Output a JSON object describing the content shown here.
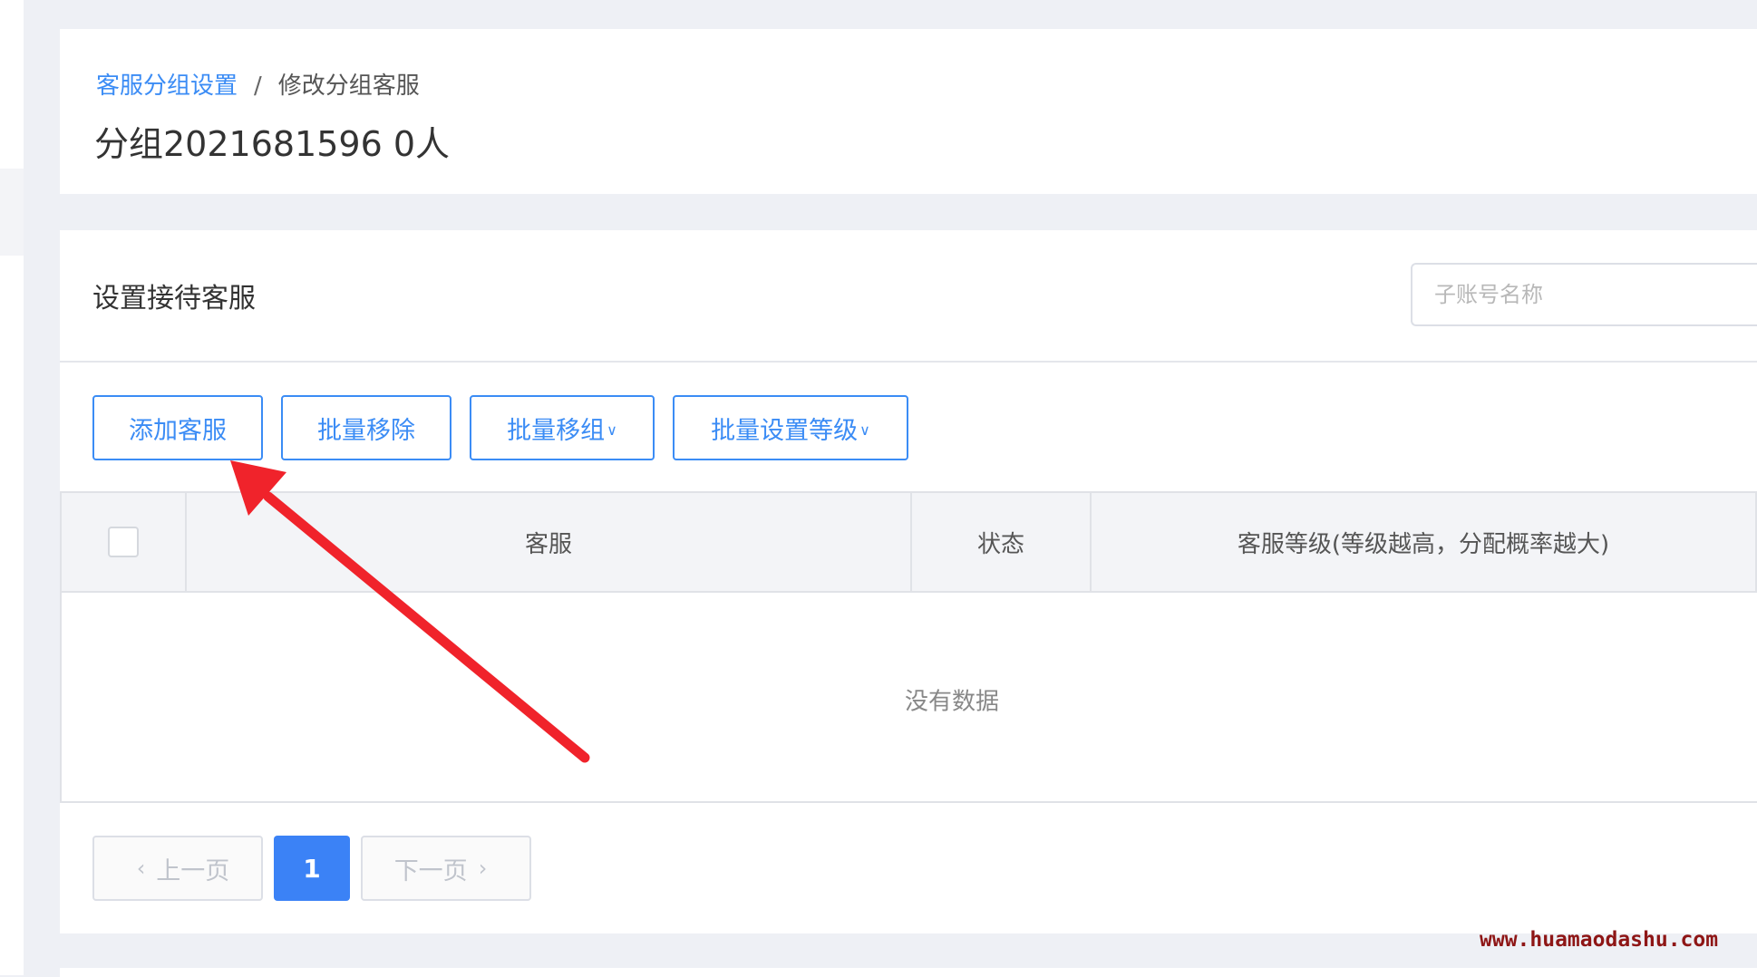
{
  "breadcrumb": {
    "parent": "客服分组设置",
    "separator": "/",
    "current": "修改分组客服"
  },
  "page_title": "分组2021681596 0人",
  "section": {
    "title": "设置接待客服",
    "search_placeholder": "子账号名称"
  },
  "toolbar": {
    "add_label": "添加客服",
    "batch_remove_label": "批量移除",
    "batch_move_label": "批量移组",
    "batch_level_label": "批量设置等级"
  },
  "table": {
    "columns": [
      "",
      "客服",
      "状态",
      "客服等级(等级越高，分配概率越大)"
    ],
    "empty_text": "没有数据"
  },
  "pagination": {
    "prev_label": "上一页",
    "current_page": "1",
    "next_label": "下一页"
  },
  "watermark": "www.huamaodashu.com",
  "colors": {
    "accent": "#3b8cf5",
    "page_active": "#3b82f6",
    "annotation_arrow": "#f0232b",
    "watermark": "#8e1616"
  },
  "icons": {
    "dropdown": "chevron-down-icon",
    "prev": "chevron-left-icon",
    "next": "chevron-right-icon"
  }
}
